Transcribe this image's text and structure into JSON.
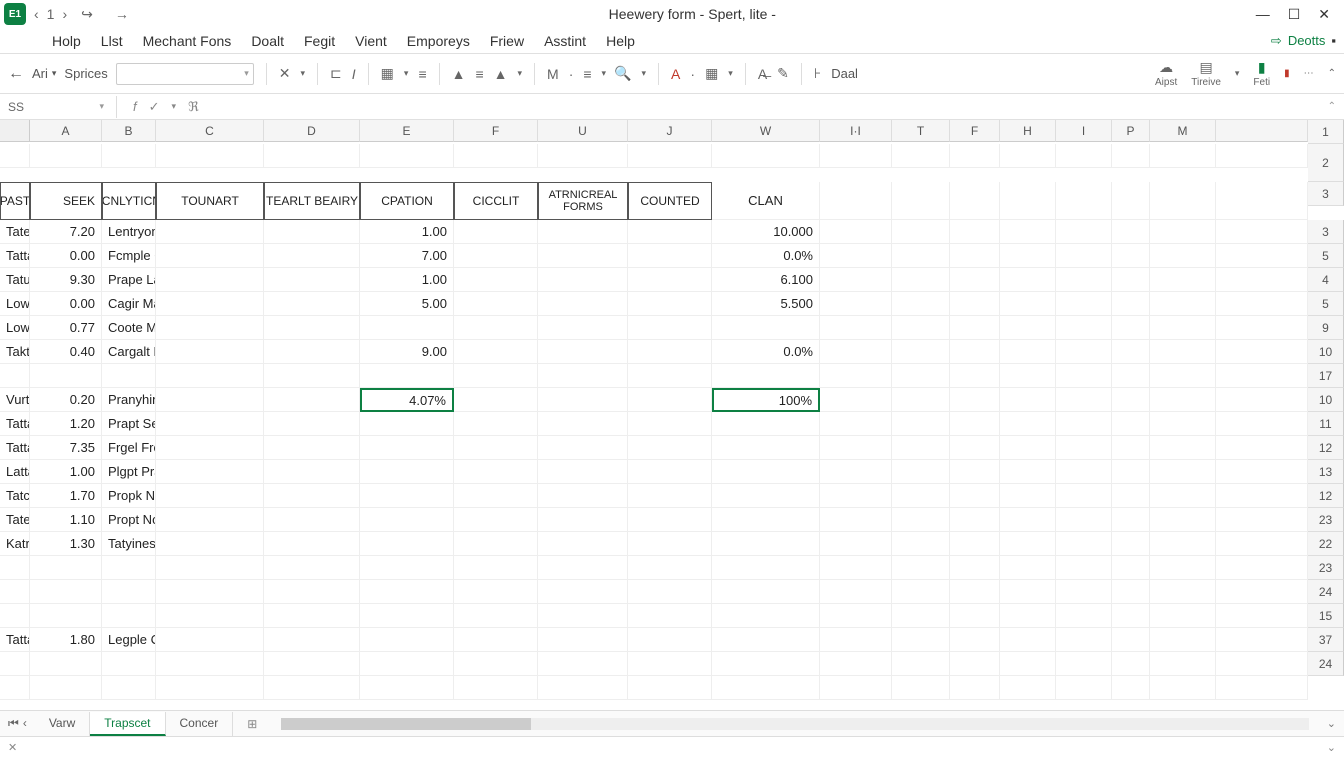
{
  "title": "Heewery form - Spert, lite -",
  "app_icon": "E1",
  "menu": [
    "Holp",
    "Llst",
    "Mechant Fons",
    "Doalt",
    "Fegit",
    "Vient",
    "Emporeys",
    "Friew",
    "Asstint",
    "Help"
  ],
  "menu_right": "Deotts",
  "toolbar": {
    "ari": "Ari",
    "sprices": "Sprices",
    "daal": "Daal",
    "aipst": "Aipst",
    "tireve": "Tireive",
    "feti": "Feti"
  },
  "formula": {
    "cell_ref": "SS"
  },
  "columns": [
    "",
    "A",
    "B",
    "C",
    "D",
    "E",
    "F",
    "U",
    "J",
    "W",
    "I·I",
    "T",
    "F",
    "H",
    "I",
    "P",
    "M",
    ""
  ],
  "row_numbers": [
    "1",
    "2",
    "2",
    "3",
    "3",
    "5",
    "4",
    "5",
    "9",
    "10",
    "17",
    "10",
    "11",
    "12",
    "13",
    "12",
    "23",
    "22",
    "23",
    "24",
    "15",
    "37",
    "24"
  ],
  "headers": {
    "past": "PAST",
    "seek": "SEEK",
    "acn": "ACNLYTICN.",
    "tounart": "TOUNART",
    "tearlt": "TEARLT BEAIRY",
    "cpation": "CPATION",
    "cicclit": "CICCLIT",
    "atrn": "ATRNICREAL FORMS",
    "counted": "COUNTED",
    "clan": "CLAN"
  },
  "rows": [
    {
      "a": "Tatea",
      "b": "7.20",
      "c": "Lentryoms",
      "f": "1.00",
      "h": "10.000"
    },
    {
      "a": "Tatta",
      "b": "0.00",
      "c": "Fcmple Codd",
      "f": "7.00",
      "h": "0.0%"
    },
    {
      "a": "Tatua",
      "b": "9.30",
      "c": "Prape Laagdet",
      "f": "1.00",
      "h": "6.100"
    },
    {
      "a": "Lowa",
      "b": "0.00",
      "c": "Cagir Mage",
      "f": "5.00",
      "h": "5.500"
    },
    {
      "a": "Lowra",
      "b": "0.77",
      "c": "Coote Maudsl",
      "f": "",
      "h": ""
    },
    {
      "a": "Takta",
      "b": "0.40",
      "c": "Cargalt Neda",
      "f": "9.00",
      "h": "0.0%"
    },
    {
      "a": "",
      "b": "",
      "c": "",
      "f": "",
      "h": ""
    },
    {
      "a": "Vurtem",
      "b": "0.20",
      "c": "Pranyhing",
      "f": "4.07%",
      "h": "100%",
      "sel": true
    },
    {
      "a": "Tatta",
      "b": "1.20",
      "c": "Prapt Seier",
      "f": "",
      "h": ""
    },
    {
      "a": "Tatta",
      "b": "7.35",
      "c": "Frgel Freciap",
      "f": "",
      "h": ""
    },
    {
      "a": "Latta",
      "b": "1.00",
      "c": "Plgpt Prased",
      "f": "",
      "h": ""
    },
    {
      "a": "Tatca",
      "b": "1.70",
      "c": "Propk Nirter",
      "f": "",
      "h": ""
    },
    {
      "a": "Tatea",
      "b": "1.10",
      "c": "Propt Noudet",
      "f": "",
      "h": ""
    },
    {
      "a": "Katra",
      "b": "1.30",
      "c": "Tatyiness",
      "f": "",
      "h": ""
    },
    {
      "a": "",
      "b": "",
      "c": "",
      "f": "",
      "h": ""
    },
    {
      "a": "",
      "b": "",
      "c": "",
      "f": "",
      "h": ""
    },
    {
      "a": "",
      "b": "",
      "c": "",
      "f": "",
      "h": ""
    },
    {
      "a": "Tatta",
      "b": "1.80",
      "c": "Legple Conipion",
      "f": "",
      "h": ""
    },
    {
      "a": "",
      "b": "",
      "c": "",
      "f": "",
      "h": ""
    },
    {
      "a": "",
      "b": "",
      "c": "",
      "f": "",
      "h": ""
    }
  ],
  "sheets": [
    "Varw",
    "Trapscet",
    "Concer"
  ],
  "active_sheet": 1
}
